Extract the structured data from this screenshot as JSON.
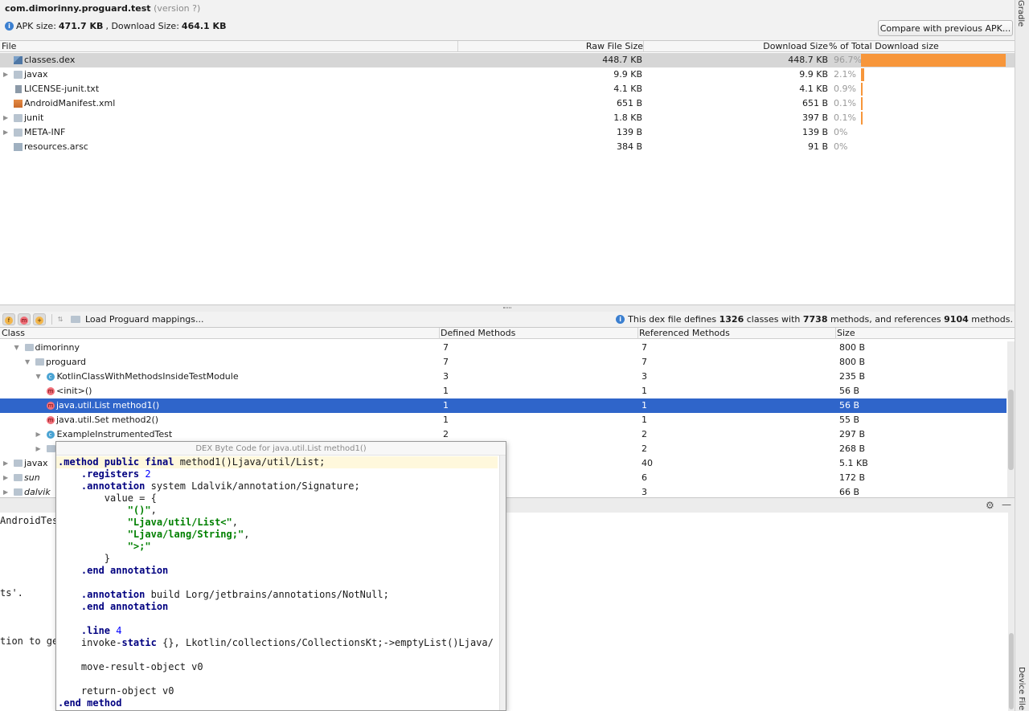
{
  "header": {
    "package": "com.dimorinny.proguard.test",
    "version_note": "(version ?)",
    "apk_size_label": "APK size: ",
    "apk_size": "471.7 KB",
    "download_size_label": ", Download Size: ",
    "download_size": "464.1 KB",
    "compare_label": "Compare with previous APK..."
  },
  "side_tabs": {
    "gradle": "Gradle",
    "device": "Device File"
  },
  "file_table": {
    "columns": [
      "File",
      "Raw File Size",
      "Download Size",
      "% of Total Download size"
    ],
    "rows": [
      {
        "name": "classes.dex",
        "raw": "448.7 KB",
        "download": "448.7 KB",
        "percent": "96.7%",
        "share": 0.967,
        "expandable": false,
        "icon": "dex-file-icon",
        "selected": true
      },
      {
        "name": "javax",
        "raw": "9.9 KB",
        "download": "9.9 KB",
        "percent": "2.1%",
        "share": 0.021,
        "expandable": true,
        "icon": "folder-icon",
        "selected": false
      },
      {
        "name": "LICENSE-junit.txt",
        "raw": "4.1 KB",
        "download": "4.1 KB",
        "percent": "0.9%",
        "share": 0.009,
        "expandable": false,
        "icon": "text-file-icon",
        "selected": false
      },
      {
        "name": "AndroidManifest.xml",
        "raw": "651 B",
        "download": "651 B",
        "percent": "0.1%",
        "share": 0.001,
        "expandable": false,
        "icon": "xml-file-icon",
        "selected": false
      },
      {
        "name": "junit",
        "raw": "1.8 KB",
        "download": "397 B",
        "percent": "0.1%",
        "share": 0.001,
        "expandable": true,
        "icon": "folder-icon",
        "selected": false
      },
      {
        "name": "META-INF",
        "raw": "139 B",
        "download": "139 B",
        "percent": "0%",
        "share": 0,
        "expandable": true,
        "icon": "folder-icon",
        "selected": false
      },
      {
        "name": "resources.arsc",
        "raw": "384 B",
        "download": "91 B",
        "percent": "0%",
        "share": 0,
        "expandable": false,
        "icon": "arsc-file-icon",
        "selected": false
      }
    ]
  },
  "class_toolbar": {
    "filter_fields_glyph": "f",
    "filter_methods_glyph": "m",
    "filter_refs_glyph": "+",
    "load_mappings_label": "Load Proguard mappings...",
    "summary_prefix": "This dex file defines ",
    "classes_count": "1326",
    "summary_mid1": " classes with ",
    "methods_count": "7738",
    "summary_mid2": " methods, and references ",
    "refs_count": "9104",
    "summary_suffix": " methods."
  },
  "class_table": {
    "columns": [
      "Class",
      "Defined Methods",
      "Referenced Methods",
      "Size"
    ],
    "rows": [
      {
        "name": "dimorinny",
        "defined": "7",
        "referenced": "7",
        "size": "800 B",
        "kind": "package",
        "depth": 1,
        "arrow": "▼",
        "italic": false,
        "selected": false
      },
      {
        "name": "proguard",
        "defined": "7",
        "referenced": "7",
        "size": "800 B",
        "kind": "package",
        "depth": 2,
        "arrow": "▼",
        "italic": false,
        "selected": false
      },
      {
        "name": "KotlinClassWithMethodsInsideTestModule",
        "defined": "3",
        "referenced": "3",
        "size": "235 B",
        "kind": "class",
        "depth": 3,
        "arrow": "▼",
        "italic": false,
        "selected": false
      },
      {
        "name": "<init>()",
        "defined": "1",
        "referenced": "1",
        "size": "56 B",
        "kind": "method",
        "depth": 4,
        "arrow": "",
        "italic": false,
        "selected": false
      },
      {
        "name": "java.util.List method1()",
        "defined": "1",
        "referenced": "1",
        "size": "56 B",
        "kind": "method",
        "depth": 4,
        "arrow": "",
        "italic": false,
        "selected": true
      },
      {
        "name": "java.util.Set method2()",
        "defined": "1",
        "referenced": "1",
        "size": "55 B",
        "kind": "method",
        "depth": 4,
        "arrow": "",
        "italic": false,
        "selected": false
      },
      {
        "name": "ExampleInstrumentedTest",
        "defined": "2",
        "referenced": "2",
        "size": "297 B",
        "kind": "class",
        "depth": 3,
        "arrow": "▶",
        "italic": false,
        "selected": false
      },
      {
        "name": "",
        "defined": "",
        "referenced": "2",
        "size": "268 B",
        "kind": "package",
        "depth": 3,
        "arrow": "▶",
        "italic": false,
        "selected": false
      },
      {
        "name": "javax",
        "defined": "",
        "referenced": "40",
        "size": "5.1 KB",
        "kind": "package",
        "depth": 0,
        "arrow": "▶",
        "italic": false,
        "selected": false
      },
      {
        "name": "sun",
        "defined": "",
        "referenced": "6",
        "size": "172 B",
        "kind": "package",
        "depth": 0,
        "arrow": "▶",
        "italic": true,
        "selected": false
      },
      {
        "name": "dalvik",
        "defined": "",
        "referenced": "3",
        "size": "66 B",
        "kind": "package",
        "depth": 0,
        "arrow": "▶",
        "italic": true,
        "selected": false
      }
    ]
  },
  "console": {
    "lines": [
      {
        "text": "AndroidTes",
        "row": 0
      },
      {
        "text": "ts'.",
        "row": 6
      },
      {
        "text": "tion to ge",
        "row": 10
      }
    ]
  },
  "bytecode_popup": {
    "title": "DEX Byte Code for java.util.List method1()",
    "lines": [
      [
        {
          "t": ".method public final ",
          "c": "kw"
        },
        {
          "t": "method1()Ljava/util/List;",
          "c": ""
        }
      ],
      [
        {
          "t": "    .registers ",
          "c": "kw"
        },
        {
          "t": "2",
          "c": "num"
        }
      ],
      [
        {
          "t": "    .annotation ",
          "c": "kw"
        },
        {
          "t": "system Ldalvik/annotation/Signature;",
          "c": ""
        }
      ],
      [
        {
          "t": "        value = {",
          "c": ""
        }
      ],
      [
        {
          "t": "            \"()\"",
          "c": "str"
        },
        {
          "t": ",",
          "c": ""
        }
      ],
      [
        {
          "t": "            \"Ljava/util/List<\"",
          "c": "str"
        },
        {
          "t": ",",
          "c": ""
        }
      ],
      [
        {
          "t": "            \"Ljava/lang/String;\"",
          "c": "str"
        },
        {
          "t": ",",
          "c": ""
        }
      ],
      [
        {
          "t": "            \">;\"",
          "c": "str"
        }
      ],
      [
        {
          "t": "        }",
          "c": ""
        }
      ],
      [
        {
          "t": "    .end annotation",
          "c": "kw"
        }
      ],
      [],
      [
        {
          "t": "    .annotation ",
          "c": "kw"
        },
        {
          "t": "build Lorg/jetbrains/annotations/NotNull;",
          "c": ""
        }
      ],
      [
        {
          "t": "    .end annotation",
          "c": "kw"
        }
      ],
      [],
      [
        {
          "t": "    .line ",
          "c": "kw"
        },
        {
          "t": "4",
          "c": "num"
        }
      ],
      [
        {
          "t": "    invoke-",
          "c": ""
        },
        {
          "t": "static",
          "c": "kw"
        },
        {
          "t": " {}, Lkotlin/collections/CollectionsKt;->emptyList()Ljava/",
          "c": ""
        }
      ],
      [],
      [
        {
          "t": "    move-result-object v0",
          "c": ""
        }
      ],
      [],
      [
        {
          "t": "    return-object v0",
          "c": ""
        }
      ],
      [
        {
          "t": ".end method",
          "c": "kw"
        }
      ]
    ]
  },
  "colors": {
    "download_bar": "#f7963a",
    "selection": "#2f65ca",
    "file_selection": "#d6d6d6"
  }
}
